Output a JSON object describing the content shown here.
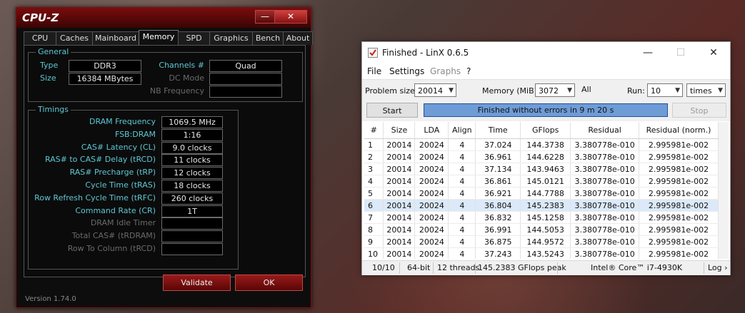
{
  "cpuz": {
    "title": "CPU-Z",
    "tabs": [
      "CPU",
      "Caches",
      "Mainboard",
      "Memory",
      "SPD",
      "Graphics",
      "Bench",
      "About"
    ],
    "active_tab": "Memory",
    "general": {
      "label": "General",
      "type_label": "Type",
      "type_value": "DDR3",
      "size_label": "Size",
      "size_value": "16384 MBytes",
      "channels_label": "Channels #",
      "channels_value": "Quad",
      "dc_mode_label": "DC Mode",
      "nb_freq_label": "NB Frequency"
    },
    "timings": {
      "label": "Timings",
      "rows": [
        {
          "label": "DRAM Frequency",
          "value": "1069.5 MHz",
          "enabled": true
        },
        {
          "label": "FSB:DRAM",
          "value": "1:16",
          "enabled": true
        },
        {
          "label": "CAS# Latency (CL)",
          "value": "9.0 clocks",
          "enabled": true
        },
        {
          "label": "RAS# to CAS# Delay (tRCD)",
          "value": "11 clocks",
          "enabled": true
        },
        {
          "label": "RAS# Precharge (tRP)",
          "value": "12 clocks",
          "enabled": true
        },
        {
          "label": "Cycle Time (tRAS)",
          "value": "18 clocks",
          "enabled": true
        },
        {
          "label": "Row Refresh Cycle Time (tRFC)",
          "value": "260 clocks",
          "enabled": true
        },
        {
          "label": "Command Rate (CR)",
          "value": "1T",
          "enabled": true
        },
        {
          "label": "DRAM Idle Timer",
          "value": "",
          "enabled": false
        },
        {
          "label": "Total CAS# (tRDRAM)",
          "value": "",
          "enabled": false
        },
        {
          "label": "Row To Column (tRCD)",
          "value": "",
          "enabled": false
        }
      ]
    },
    "validate_label": "Validate",
    "ok_label": "OK",
    "version": "Version 1.74.0",
    "close_glyph": "✕",
    "min_glyph": "—"
  },
  "linx": {
    "title": "Finished - LinX 0.6.5",
    "menu": [
      {
        "label": "File",
        "disabled": false
      },
      {
        "label": "Settings",
        "disabled": false
      },
      {
        "label": "Graphs",
        "disabled": true
      },
      {
        "label": "?",
        "disabled": false
      }
    ],
    "problem_size_label": "Problem size:",
    "problem_size_value": "20014",
    "memory_label": "Memory (MiB):",
    "memory_value": "3072",
    "all_label": "All",
    "run_label": "Run:",
    "run_value": "10",
    "run_unit": "times",
    "start_label": "Start",
    "stop_label": "Stop",
    "progress_text": "Finished without errors in 9 m 20 s",
    "progress_fraction": 1.0,
    "columns": [
      "#",
      "Size",
      "LDA",
      "Align",
      "Time",
      "GFlops",
      "Residual",
      "Residual (norm.)"
    ],
    "rows": [
      [
        "1",
        "20014",
        "20024",
        "4",
        "37.024",
        "144.3738",
        "3.380778e-010",
        "2.995981e-002"
      ],
      [
        "2",
        "20014",
        "20024",
        "4",
        "36.961",
        "144.6228",
        "3.380778e-010",
        "2.995981e-002"
      ],
      [
        "3",
        "20014",
        "20024",
        "4",
        "37.134",
        "143.9463",
        "3.380778e-010",
        "2.995981e-002"
      ],
      [
        "4",
        "20014",
        "20024",
        "4",
        "36.861",
        "145.0121",
        "3.380778e-010",
        "2.995981e-002"
      ],
      [
        "5",
        "20014",
        "20024",
        "4",
        "36.921",
        "144.7788",
        "3.380778e-010",
        "2.995981e-002"
      ],
      [
        "6",
        "20014",
        "20024",
        "4",
        "36.804",
        "145.2383",
        "3.380778e-010",
        "2.995981e-002"
      ],
      [
        "7",
        "20014",
        "20024",
        "4",
        "36.832",
        "145.1258",
        "3.380778e-010",
        "2.995981e-002"
      ],
      [
        "8",
        "20014",
        "20024",
        "4",
        "36.991",
        "144.5053",
        "3.380778e-010",
        "2.995981e-002"
      ],
      [
        "9",
        "20014",
        "20024",
        "4",
        "36.875",
        "144.9572",
        "3.380778e-010",
        "2.995981e-002"
      ],
      [
        "10",
        "20014",
        "20024",
        "4",
        "37.243",
        "143.5243",
        "3.380778e-010",
        "2.995981e-002"
      ]
    ],
    "selected_row": 5,
    "status": {
      "runs": "10/10",
      "bits": "64-bit",
      "threads": "12 threads",
      "peak": "145.2383 GFlops peak",
      "cpu": "Intel® Core™ i7-4930K",
      "log": "Log ›"
    },
    "min_glyph": "—",
    "max_glyph": "☐",
    "close_glyph": "✕"
  }
}
